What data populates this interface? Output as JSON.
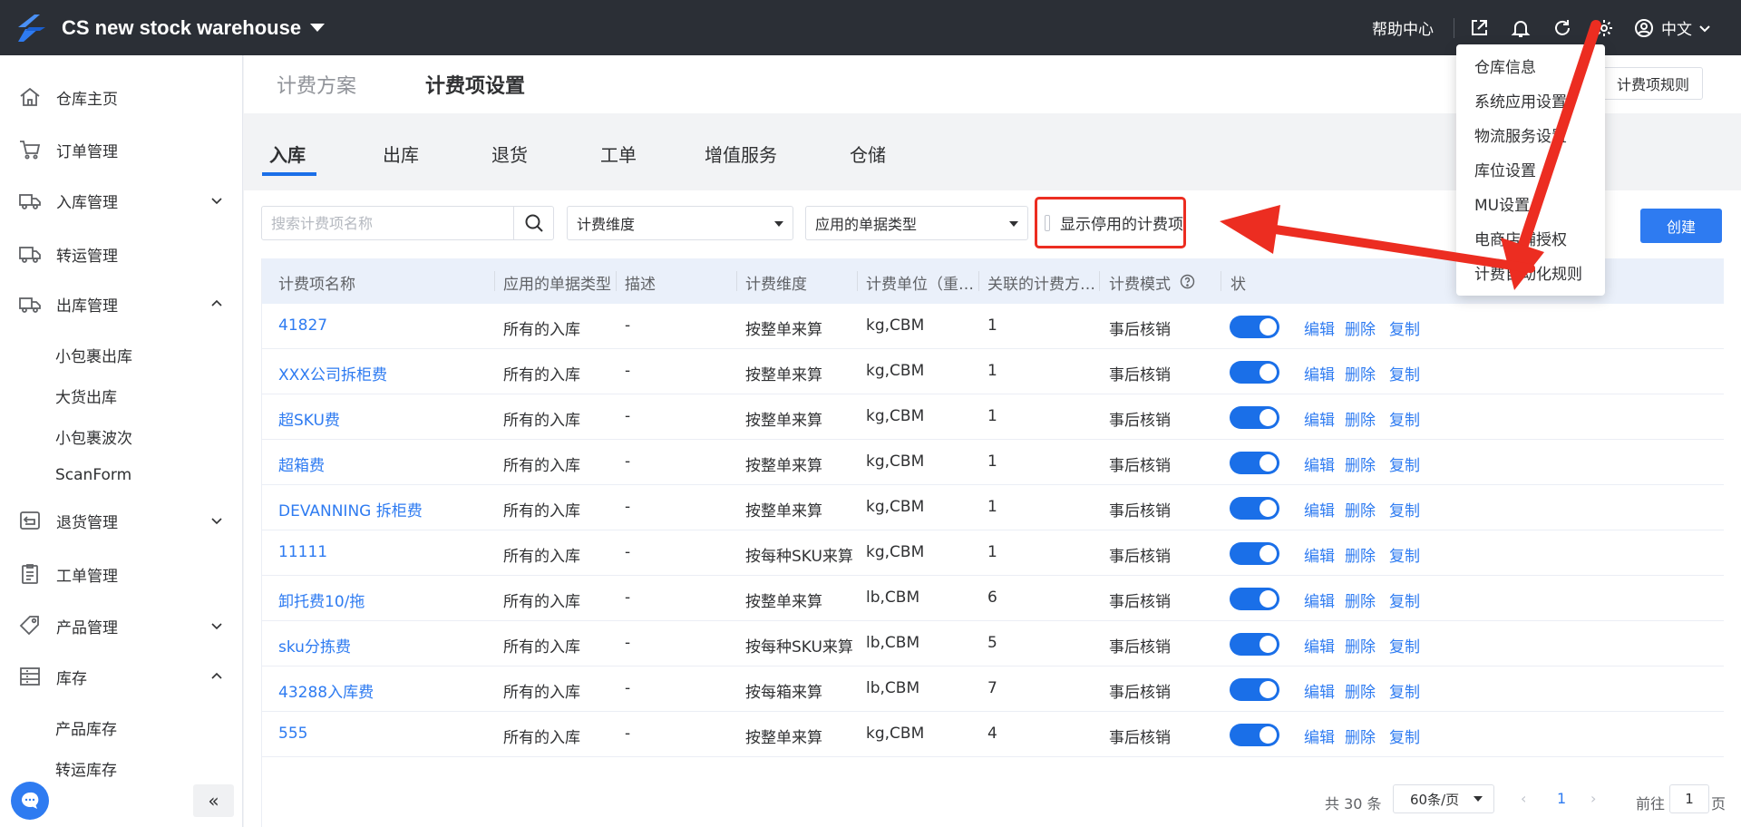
{
  "app": {
    "title": "CS new stock warehouse"
  },
  "topbar": {
    "help": "帮助中心",
    "language": "中文"
  },
  "sidebar": {
    "items": [
      {
        "label": "仓库主页",
        "icon": "home-icon"
      },
      {
        "label": "订单管理",
        "icon": "cart-icon"
      },
      {
        "label": "入库管理",
        "icon": "inbound-truck-icon"
      },
      {
        "label": "转运管理",
        "icon": "transfer-icon"
      },
      {
        "label": "出库管理",
        "icon": "outbound-truck-icon"
      },
      {
        "label": "退货管理",
        "icon": "return-icon"
      },
      {
        "label": "工单管理",
        "icon": "clipboard-icon"
      },
      {
        "label": "产品管理",
        "icon": "tag-icon"
      },
      {
        "label": "库存",
        "icon": "inventory-icon"
      }
    ],
    "outbound_sub": [
      "小包裹出库",
      "大货出库",
      "小包裹波次",
      "ScanForm"
    ],
    "inventory_sub": [
      "产品库存",
      "转运库存"
    ],
    "collapse_label": "«"
  },
  "header": {
    "tabs": [
      "计费方案",
      "计费项设置"
    ],
    "right_button": "计费项规则"
  },
  "subtabs": [
    "入库",
    "出库",
    "退货",
    "工单",
    "增值服务",
    "仓储"
  ],
  "filters": {
    "search_placeholder": "搜索计费项名称",
    "dimension": "计费维度",
    "doc_type": "应用的单据类型",
    "show_disabled": "显示停用的计费项",
    "create": "创建"
  },
  "table": {
    "headers": [
      "计费项名称",
      "应用的单据类型",
      "描述",
      "计费维度",
      "计费单位（重…",
      "关联的计费方…",
      "计费模式",
      "状"
    ],
    "rows": [
      {
        "name": "41827",
        "doc": "所有的入库",
        "desc": "-",
        "dim": "按整单来算",
        "unit": "kg,CBM",
        "count": "1",
        "mode": "事后核销"
      },
      {
        "name": "XXX公司拆柜费",
        "doc": "所有的入库",
        "desc": "-",
        "dim": "按整单来算",
        "unit": "kg,CBM",
        "count": "1",
        "mode": "事后核销"
      },
      {
        "name": "超SKU费",
        "doc": "所有的入库",
        "desc": "-",
        "dim": "按整单来算",
        "unit": "kg,CBM",
        "count": "1",
        "mode": "事后核销"
      },
      {
        "name": "超箱费",
        "doc": "所有的入库",
        "desc": "-",
        "dim": "按整单来算",
        "unit": "kg,CBM",
        "count": "1",
        "mode": "事后核销"
      },
      {
        "name": "DEVANNING 拆柜费",
        "doc": "所有的入库",
        "desc": "-",
        "dim": "按整单来算",
        "unit": "kg,CBM",
        "count": "1",
        "mode": "事后核销"
      },
      {
        "name": "11111",
        "doc": "所有的入库",
        "desc": "-",
        "dim": "按每种SKU来算",
        "unit": "kg,CBM",
        "count": "1",
        "mode": "事后核销"
      },
      {
        "name": "卸托费10/拖",
        "doc": "所有的入库",
        "desc": "-",
        "dim": "按整单来算",
        "unit": "lb,CBM",
        "count": "6",
        "mode": "事后核销"
      },
      {
        "name": "sku分拣费",
        "doc": "所有的入库",
        "desc": "-",
        "dim": "按每种SKU来算",
        "unit": "lb,CBM",
        "count": "5",
        "mode": "事后核销"
      },
      {
        "name": "43288入库费",
        "doc": "所有的入库",
        "desc": "-",
        "dim": "按每箱来算",
        "unit": "lb,CBM",
        "count": "7",
        "mode": "事后核销"
      },
      {
        "name": "555",
        "doc": "所有的入库",
        "desc": "-",
        "dim": "按整单来算",
        "unit": "kg,CBM",
        "count": "4",
        "mode": "事后核销"
      }
    ],
    "actions": {
      "edit": "编辑",
      "delete": "删除",
      "copy": "复制"
    }
  },
  "pagination": {
    "total": "共 30 条",
    "page_size": "60条/页",
    "current": "1",
    "goto_prefix": "前往",
    "goto_value": "1",
    "goto_suffix": "页"
  },
  "settings_menu": [
    "仓库信息",
    "系统应用设置",
    "物流服务设置",
    "库位设置",
    "MU设置",
    "电商店铺授权",
    "计费自动化规则"
  ],
  "colors": {
    "primary": "#2e7bf1",
    "topbar": "#2b2f36",
    "annotation": "#ec2d21"
  }
}
